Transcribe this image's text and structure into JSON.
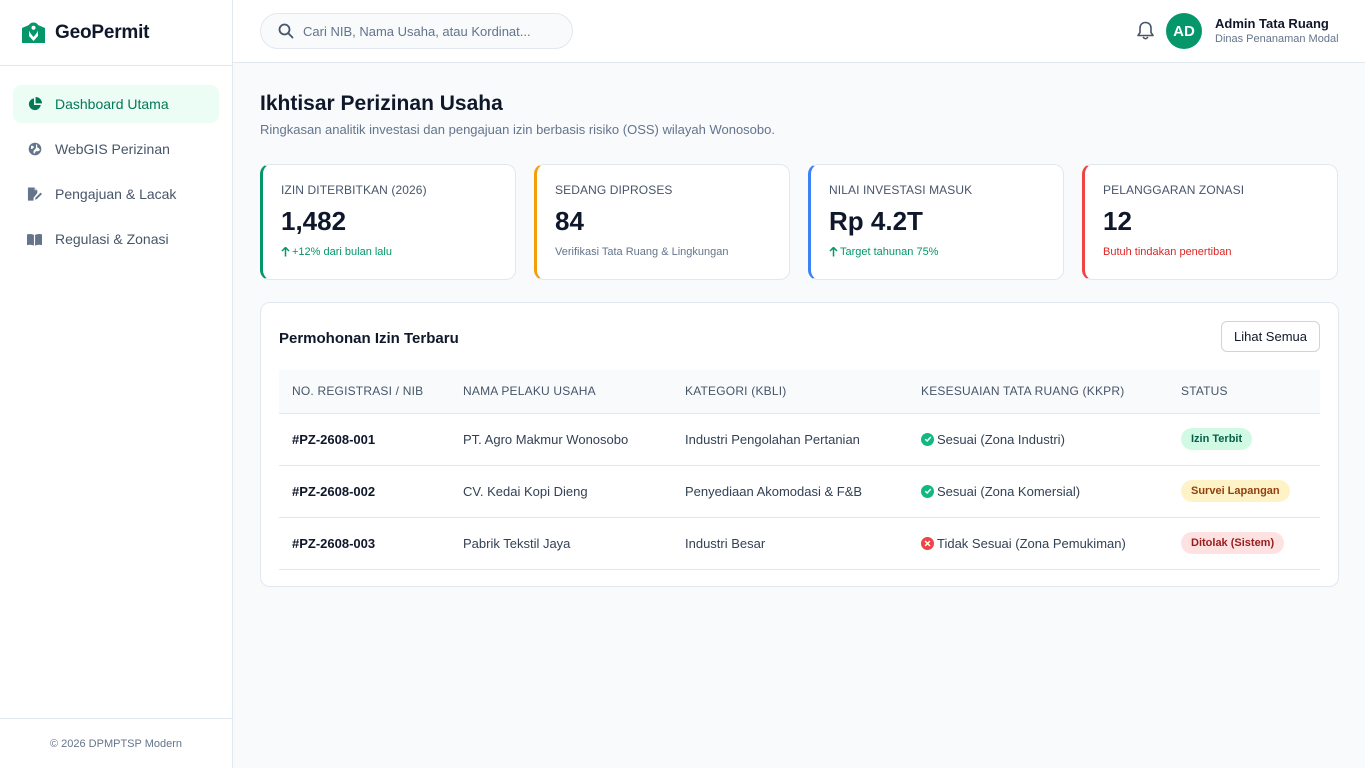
{
  "app": {
    "name": "GeoPermit"
  },
  "sidebar": {
    "items": [
      {
        "label": "Dashboard Utama",
        "icon": "pie-chart-icon",
        "active": true
      },
      {
        "label": "WebGIS Perizinan",
        "icon": "globe-icon",
        "active": false
      },
      {
        "label": "Pengajuan & Lacak",
        "icon": "file-signature-icon",
        "active": false
      },
      {
        "label": "Regulasi & Zonasi",
        "icon": "book-open-icon",
        "active": false
      }
    ],
    "footer": "© 2026 DPMPTSP Modern"
  },
  "topbar": {
    "search_placeholder": "Cari NIB, Nama Usaha, atau Kordinat...",
    "user": {
      "initials": "AD",
      "name": "Admin Tata Ruang",
      "role": "Dinas Penanaman Modal"
    }
  },
  "page": {
    "title": "Ikhtisar Perizinan Usaha",
    "subtitle": "Ringkasan analitik investasi dan pengajuan izin berbasis risiko (OSS) wilayah Wonosobo."
  },
  "stats": [
    {
      "label": "IZIN DITERBITKAN (2026)",
      "value": "1,482",
      "note": "+12% dari bulan lalu",
      "accent": "#059669",
      "note_color": "#059669",
      "arrow": true
    },
    {
      "label": "SEDANG DIPROSES",
      "value": "84",
      "note": "Verifikasi Tata Ruang & Lingkungan",
      "accent": "#f59e0b",
      "note_color": "#64748b",
      "arrow": false
    },
    {
      "label": "NILAI INVESTASI MASUK",
      "value": "Rp 4.2T",
      "note": "Target tahunan 75%",
      "accent": "#3b82f6",
      "note_color": "#059669",
      "arrow": true
    },
    {
      "label": "PELANGGARAN ZONASI",
      "value": "12",
      "note": "Butuh tindakan penertiban",
      "accent": "#ef4444",
      "note_color": "#dc2626",
      "arrow": false
    }
  ],
  "recent": {
    "title": "Permohonan Izin Terbaru",
    "view_all": "Lihat Semua",
    "columns": [
      "NO. REGISTRASI / NIB",
      "NAMA PELAKU USAHA",
      "KATEGORI (KBLI)",
      "KESESUAIAN TATA RUANG (KKPR)",
      "STATUS"
    ],
    "rows": [
      {
        "reg": "#PZ-2608-001",
        "name": "PT. Agro Makmur Wonosobo",
        "category": "Industri Pengolahan Pertanian",
        "kkpr": "Sesuai (Zona Industri)",
        "kkpr_ok": true,
        "status": "Izin Terbit",
        "status_bg": "#d1fae5",
        "status_fg": "#065f46"
      },
      {
        "reg": "#PZ-2608-002",
        "name": "CV. Kedai Kopi Dieng",
        "category": "Penyediaan Akomodasi & F&B",
        "kkpr": "Sesuai (Zona Komersial)",
        "kkpr_ok": true,
        "status": "Survei Lapangan",
        "status_bg": "#fef3c7",
        "status_fg": "#92400e"
      },
      {
        "reg": "#PZ-2608-003",
        "name": "Pabrik Tekstil Jaya",
        "category": "Industri Besar",
        "kkpr": "Tidak Sesuai (Zona Pemukiman)",
        "kkpr_ok": false,
        "status": "Ditolak (Sistem)",
        "status_bg": "#fee2e2",
        "status_fg": "#991b1b"
      }
    ]
  },
  "colors": {
    "brand": "#059669",
    "ok": "#10b981",
    "bad": "#ef4444"
  }
}
